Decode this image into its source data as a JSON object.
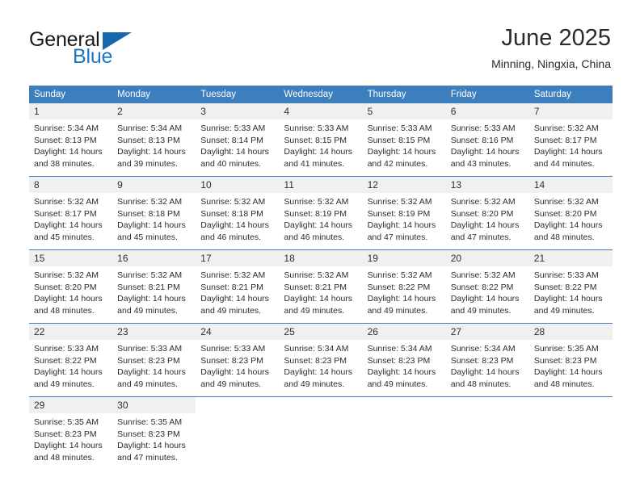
{
  "brand": {
    "name_top": "General",
    "name_bottom": "Blue",
    "color_dark": "#16191c",
    "color_blue": "#1c74c4"
  },
  "header": {
    "title": "June 2025",
    "location": "Minning, Ningxia, China"
  },
  "theme": {
    "header_band": "#3d7ebd",
    "daynum_band": "#f0f0f0",
    "text": "#2d2d2d"
  },
  "weekday_headers": [
    "Sunday",
    "Monday",
    "Tuesday",
    "Wednesday",
    "Thursday",
    "Friday",
    "Saturday"
  ],
  "labels": {
    "sunrise_prefix": "Sunrise:",
    "sunset_prefix": "Sunset:",
    "daylight_prefix": "Daylight:"
  },
  "weeks": [
    [
      {
        "day": "1",
        "sunrise": "Sunrise: 5:34 AM",
        "sunset": "Sunset: 8:13 PM",
        "daylight": "Daylight: 14 hours and 38 minutes."
      },
      {
        "day": "2",
        "sunrise": "Sunrise: 5:34 AM",
        "sunset": "Sunset: 8:13 PM",
        "daylight": "Daylight: 14 hours and 39 minutes."
      },
      {
        "day": "3",
        "sunrise": "Sunrise: 5:33 AM",
        "sunset": "Sunset: 8:14 PM",
        "daylight": "Daylight: 14 hours and 40 minutes."
      },
      {
        "day": "4",
        "sunrise": "Sunrise: 5:33 AM",
        "sunset": "Sunset: 8:15 PM",
        "daylight": "Daylight: 14 hours and 41 minutes."
      },
      {
        "day": "5",
        "sunrise": "Sunrise: 5:33 AM",
        "sunset": "Sunset: 8:15 PM",
        "daylight": "Daylight: 14 hours and 42 minutes."
      },
      {
        "day": "6",
        "sunrise": "Sunrise: 5:33 AM",
        "sunset": "Sunset: 8:16 PM",
        "daylight": "Daylight: 14 hours and 43 minutes."
      },
      {
        "day": "7",
        "sunrise": "Sunrise: 5:32 AM",
        "sunset": "Sunset: 8:17 PM",
        "daylight": "Daylight: 14 hours and 44 minutes."
      }
    ],
    [
      {
        "day": "8",
        "sunrise": "Sunrise: 5:32 AM",
        "sunset": "Sunset: 8:17 PM",
        "daylight": "Daylight: 14 hours and 45 minutes."
      },
      {
        "day": "9",
        "sunrise": "Sunrise: 5:32 AM",
        "sunset": "Sunset: 8:18 PM",
        "daylight": "Daylight: 14 hours and 45 minutes."
      },
      {
        "day": "10",
        "sunrise": "Sunrise: 5:32 AM",
        "sunset": "Sunset: 8:18 PM",
        "daylight": "Daylight: 14 hours and 46 minutes."
      },
      {
        "day": "11",
        "sunrise": "Sunrise: 5:32 AM",
        "sunset": "Sunset: 8:19 PM",
        "daylight": "Daylight: 14 hours and 46 minutes."
      },
      {
        "day": "12",
        "sunrise": "Sunrise: 5:32 AM",
        "sunset": "Sunset: 8:19 PM",
        "daylight": "Daylight: 14 hours and 47 minutes."
      },
      {
        "day": "13",
        "sunrise": "Sunrise: 5:32 AM",
        "sunset": "Sunset: 8:20 PM",
        "daylight": "Daylight: 14 hours and 47 minutes."
      },
      {
        "day": "14",
        "sunrise": "Sunrise: 5:32 AM",
        "sunset": "Sunset: 8:20 PM",
        "daylight": "Daylight: 14 hours and 48 minutes."
      }
    ],
    [
      {
        "day": "15",
        "sunrise": "Sunrise: 5:32 AM",
        "sunset": "Sunset: 8:20 PM",
        "daylight": "Daylight: 14 hours and 48 minutes."
      },
      {
        "day": "16",
        "sunrise": "Sunrise: 5:32 AM",
        "sunset": "Sunset: 8:21 PM",
        "daylight": "Daylight: 14 hours and 49 minutes."
      },
      {
        "day": "17",
        "sunrise": "Sunrise: 5:32 AM",
        "sunset": "Sunset: 8:21 PM",
        "daylight": "Daylight: 14 hours and 49 minutes."
      },
      {
        "day": "18",
        "sunrise": "Sunrise: 5:32 AM",
        "sunset": "Sunset: 8:21 PM",
        "daylight": "Daylight: 14 hours and 49 minutes."
      },
      {
        "day": "19",
        "sunrise": "Sunrise: 5:32 AM",
        "sunset": "Sunset: 8:22 PM",
        "daylight": "Daylight: 14 hours and 49 minutes."
      },
      {
        "day": "20",
        "sunrise": "Sunrise: 5:32 AM",
        "sunset": "Sunset: 8:22 PM",
        "daylight": "Daylight: 14 hours and 49 minutes."
      },
      {
        "day": "21",
        "sunrise": "Sunrise: 5:33 AM",
        "sunset": "Sunset: 8:22 PM",
        "daylight": "Daylight: 14 hours and 49 minutes."
      }
    ],
    [
      {
        "day": "22",
        "sunrise": "Sunrise: 5:33 AM",
        "sunset": "Sunset: 8:22 PM",
        "daylight": "Daylight: 14 hours and 49 minutes."
      },
      {
        "day": "23",
        "sunrise": "Sunrise: 5:33 AM",
        "sunset": "Sunset: 8:23 PM",
        "daylight": "Daylight: 14 hours and 49 minutes."
      },
      {
        "day": "24",
        "sunrise": "Sunrise: 5:33 AM",
        "sunset": "Sunset: 8:23 PM",
        "daylight": "Daylight: 14 hours and 49 minutes."
      },
      {
        "day": "25",
        "sunrise": "Sunrise: 5:34 AM",
        "sunset": "Sunset: 8:23 PM",
        "daylight": "Daylight: 14 hours and 49 minutes."
      },
      {
        "day": "26",
        "sunrise": "Sunrise: 5:34 AM",
        "sunset": "Sunset: 8:23 PM",
        "daylight": "Daylight: 14 hours and 49 minutes."
      },
      {
        "day": "27",
        "sunrise": "Sunrise: 5:34 AM",
        "sunset": "Sunset: 8:23 PM",
        "daylight": "Daylight: 14 hours and 48 minutes."
      },
      {
        "day": "28",
        "sunrise": "Sunrise: 5:35 AM",
        "sunset": "Sunset: 8:23 PM",
        "daylight": "Daylight: 14 hours and 48 minutes."
      }
    ],
    [
      {
        "day": "29",
        "sunrise": "Sunrise: 5:35 AM",
        "sunset": "Sunset: 8:23 PM",
        "daylight": "Daylight: 14 hours and 48 minutes."
      },
      {
        "day": "30",
        "sunrise": "Sunrise: 5:35 AM",
        "sunset": "Sunset: 8:23 PM",
        "daylight": "Daylight: 14 hours and 47 minutes."
      },
      {
        "day": "",
        "sunrise": "",
        "sunset": "",
        "daylight": ""
      },
      {
        "day": "",
        "sunrise": "",
        "sunset": "",
        "daylight": ""
      },
      {
        "day": "",
        "sunrise": "",
        "sunset": "",
        "daylight": ""
      },
      {
        "day": "",
        "sunrise": "",
        "sunset": "",
        "daylight": ""
      },
      {
        "day": "",
        "sunrise": "",
        "sunset": "",
        "daylight": ""
      }
    ]
  ]
}
